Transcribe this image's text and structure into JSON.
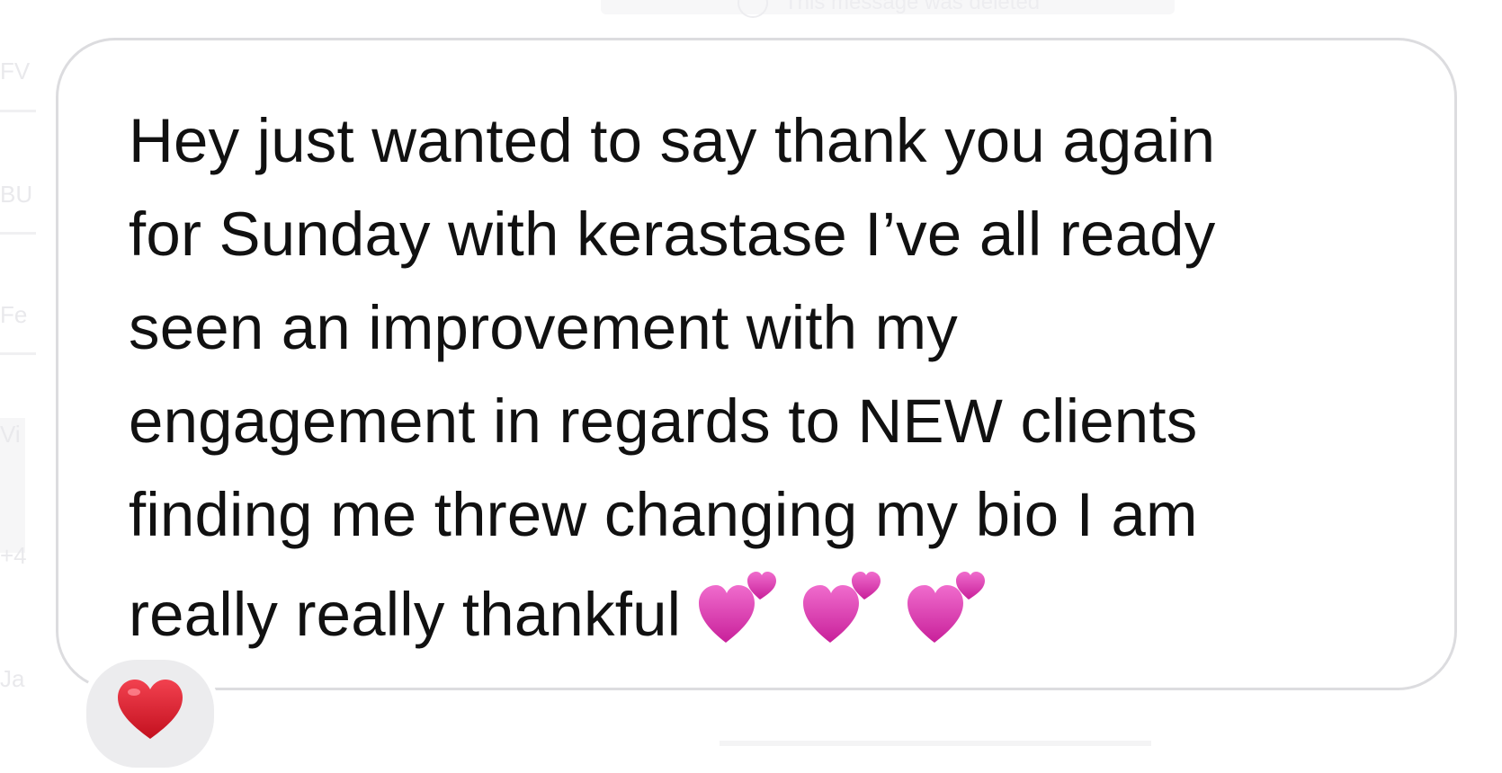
{
  "background_list": {
    "items": [
      {
        "label": "FV"
      },
      {
        "label": "BU"
      },
      {
        "label": "Fe"
      },
      {
        "label": "Vi"
      },
      {
        "label": "+4"
      },
      {
        "label": "Ja"
      }
    ]
  },
  "deleted_notice": {
    "text": "This message was deleted"
  },
  "message": {
    "text": "Hey just wanted to say thank you again\nfor Sunday with kerastase I’ve all ready\nseen an improvement with my\nengagement in regards to NEW clients\nfinding me threw changing my bio I am\nreally really thankful",
    "emojis": [
      "two-hearts-icon",
      "two-hearts-icon",
      "two-hearts-icon"
    ]
  },
  "reaction": {
    "emoji": "red-heart-icon"
  },
  "colors": {
    "text": "#111111",
    "bubble_border": "#dcdcdf",
    "reaction_bg": "#ececee",
    "heart_pink": "#e23fb4",
    "heart_red": "#d9182b"
  }
}
